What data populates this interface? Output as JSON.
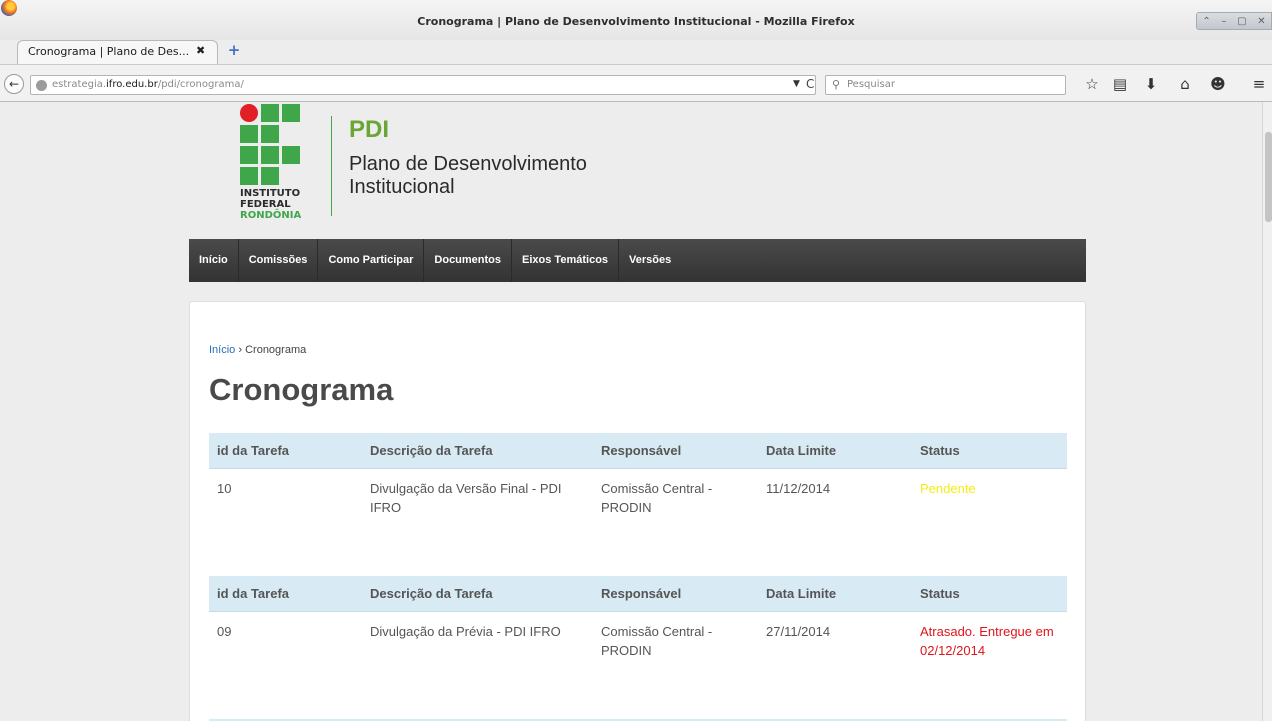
{
  "window": {
    "title": "Cronograma | Plano de Desenvolvimento Institucional - Mozilla Firefox",
    "controls": [
      "⌃",
      "–",
      "▢",
      "✕"
    ]
  },
  "tab": {
    "title": "Cronograma | Plano de Des...",
    "close": "✖",
    "new_tab": "+"
  },
  "navbar": {
    "back": "←",
    "url_prefix": "estrategia.",
    "url_host": "ifro.edu.br",
    "url_path": "/pdi/cronograma/",
    "dropmarker": "▼",
    "reload": "C",
    "search_placeholder": "Pesquisar",
    "icons": {
      "bookmark": "☆",
      "reading_list": "▤",
      "download": "⬇",
      "home": "⌂",
      "chat": "☻",
      "menu": "≡"
    }
  },
  "site": {
    "logo_line1": "INSTITUTO",
    "logo_line2": "FEDERAL",
    "logo_line3": "RONDÔNIA",
    "acronym": "PDI",
    "name": "Plano de Desenvolvimento Institucional"
  },
  "menu": {
    "items": [
      "Início",
      "Comissões",
      "Como Participar",
      "Documentos",
      "Eixos Temáticos",
      "Versões"
    ]
  },
  "breadcrumb": {
    "home": "Início",
    "separator": "›",
    "current": "Cronograma"
  },
  "page": {
    "title": "Cronograma"
  },
  "table_headers": [
    "id da Tarefa",
    "Descrição da Tarefa",
    "Responsável",
    "Data Limite",
    "Status"
  ],
  "tasks": [
    {
      "id": "10",
      "description": "Divulgação da Versão Final - PDI IFRO",
      "responsible": "Comissão Central - PRODIN",
      "deadline": "11/12/2014",
      "status": "Pendente",
      "status_color": "#f4ee12"
    },
    {
      "id": "09",
      "description": "Divulgação da Prévia - PDI IFRO",
      "responsible": "Comissão Central - PRODIN",
      "deadline": "27/11/2014",
      "status": "Atrasado. Entregue em 02/12/2014",
      "status_color": "#e0141b"
    }
  ],
  "colors": {
    "menu_bg": "#3d3d3d",
    "table_header_bg": "#d8eaf4",
    "logo_green": "#3fa64a",
    "logo_red": "#e21e26",
    "link": "#2a6fb7"
  }
}
